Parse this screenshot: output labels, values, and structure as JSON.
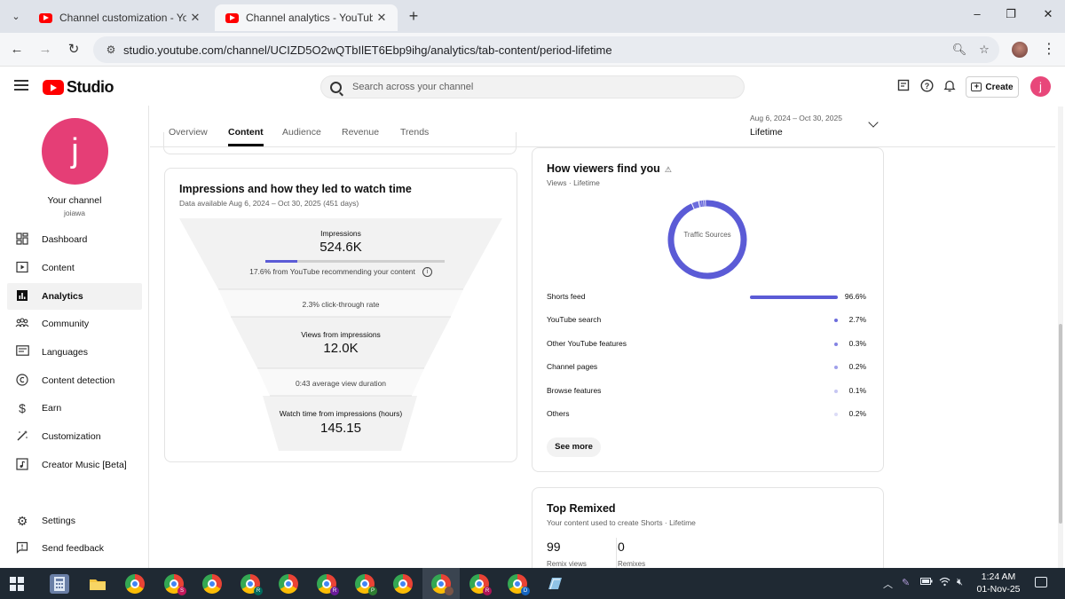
{
  "browser": {
    "tabs": [
      {
        "title": "Channel customization - YouTube Studio"
      },
      {
        "title": "Channel analytics - YouTube Studio"
      }
    ],
    "new_tab": "+",
    "url": "studio.youtube.com/channel/UCIZD5O2wQTbIlET6Ebp9ihg/analytics/tab-content/period-lifetime",
    "window_controls": {
      "minimize": "–",
      "maximize": "❐",
      "close": "✕"
    },
    "back": "←",
    "forward": "→",
    "reload": "↻",
    "menu": "⋮"
  },
  "header": {
    "logo_text": "Studio",
    "search_placeholder": "Search across your channel",
    "create_label": "Create",
    "avatar_letter": "j"
  },
  "sidebar": {
    "avatar_letter": "j",
    "channel_title": "Your channel",
    "channel_name": "joiawa",
    "items": [
      {
        "label": "Dashboard",
        "icon": "dashboard-icon"
      },
      {
        "label": "Content",
        "icon": "content-icon"
      },
      {
        "label": "Analytics",
        "icon": "analytics-icon",
        "active": true
      },
      {
        "label": "Community",
        "icon": "community-icon"
      },
      {
        "label": "Languages",
        "icon": "languages-icon"
      },
      {
        "label": "Content detection",
        "icon": "copyright-icon"
      },
      {
        "label": "Earn",
        "icon": "dollar-icon"
      },
      {
        "label": "Customization",
        "icon": "magic-wand-icon"
      },
      {
        "label": "Creator Music [Beta]",
        "icon": "music-icon"
      }
    ],
    "bottom_items": [
      {
        "label": "Settings",
        "icon": "gear-icon"
      },
      {
        "label": "Send feedback",
        "icon": "feedback-icon"
      }
    ]
  },
  "analytics": {
    "tabs": [
      "Overview",
      "Content",
      "Audience",
      "Revenue",
      "Trends"
    ],
    "active_tab": "Content",
    "period": {
      "range": "Aug 6, 2024 – Oct 30, 2025",
      "label": "Lifetime"
    }
  },
  "impressions_card": {
    "title": "Impressions and how they led to watch time",
    "subtitle": "Data available Aug 6, 2024 – Oct 30, 2025 (451 days)",
    "impressions_label": "Impressions",
    "impressions_value": "524.6K",
    "recommend_fraction": 0.176,
    "recommend_note": "17.6% from YouTube recommending your content",
    "ctr_note": "2.3% click-through rate",
    "views_label": "Views from impressions",
    "views_value": "12.0K",
    "avd_note": "0:43 average view duration",
    "watch_label": "Watch time from impressions (hours)",
    "watch_value": "145.15"
  },
  "traffic_card": {
    "title": "How viewers find you",
    "subtitle": "Views · Lifetime",
    "donut_label": "Traffic Sources",
    "sources": [
      {
        "name": "Shorts feed",
        "pct": "96.6%",
        "value": 96.6,
        "color": "#5b5bd6"
      },
      {
        "name": "YouTube search",
        "pct": "2.7%",
        "value": 2.7,
        "color": "#6c6cdc"
      },
      {
        "name": "Other YouTube features",
        "pct": "0.3%",
        "value": 0.3,
        "color": "#8383e3"
      },
      {
        "name": "Channel pages",
        "pct": "0.2%",
        "value": 0.2,
        "color": "#a0a0ea"
      },
      {
        "name": "Browse features",
        "pct": "0.1%",
        "value": 0.1,
        "color": "#c6c6f2"
      },
      {
        "name": "Others",
        "pct": "0.2%",
        "value": 0.2,
        "color": "#dcdcf7"
      }
    ],
    "see_more": "See more"
  },
  "remix_card": {
    "title": "Top Remixed",
    "subtitle": "Your content used to create Shorts · Lifetime",
    "stats": [
      {
        "value": "99",
        "label": "Remix views"
      },
      {
        "value": "0",
        "label": "Remixes"
      }
    ]
  },
  "taskbar": {
    "time": "1:24 AM",
    "date": "01-Nov-25",
    "profile_badges": [
      "S",
      "R",
      "R",
      "P",
      "R",
      "D"
    ]
  }
}
